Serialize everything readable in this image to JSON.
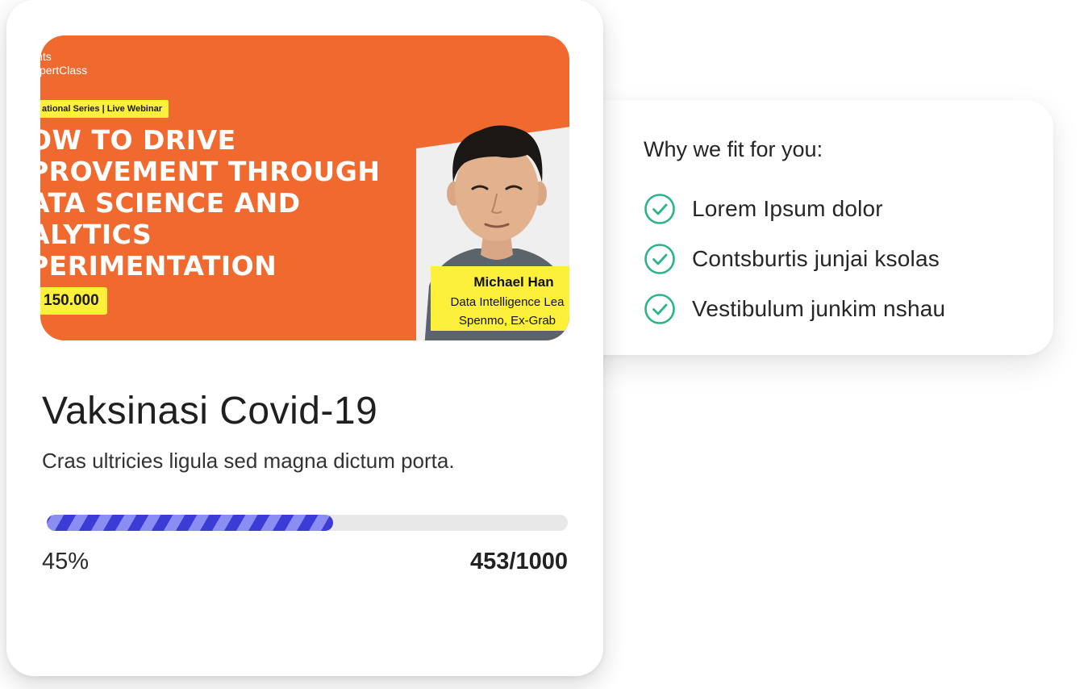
{
  "benefits": {
    "title": "Why we fit for you:",
    "items": [
      {
        "label": "Lorem Ipsum dolor",
        "icon": "check-circle-icon"
      },
      {
        "label": "Contsburtis junjai ksolas",
        "icon": "check-circle-icon"
      },
      {
        "label": "Vestibulum junkim nshau",
        "icon": "check-circle-icon"
      }
    ]
  },
  "banner": {
    "brand_line1": "ints",
    "brand_line2": "xpertClass",
    "series": "ational Series | Live Webinar",
    "headline": [
      "OW TO DRIVE",
      "PROVEMENT THROUGH",
      "ATA SCIENCE AND",
      "ALYTICS",
      "PERIMENTATION"
    ],
    "price": "150.000",
    "speaker_name": "Michael Han",
    "speaker_role_line1": "Data Intelligence Lea",
    "speaker_role_line2": "Spenmo, Ex-Grab"
  },
  "card": {
    "title": "Vaksinasi Covid-19",
    "description": "Cras ultricies ligula sed magna dictum porta.",
    "progress_fraction": 0.55,
    "progress_percent_label": "45%",
    "progress_count_label": "453/1000"
  },
  "colors": {
    "accent": "#3b3bd6",
    "accent_light": "#8b8df2",
    "check": "#2ab38c",
    "banner_orange": "#f06a2f",
    "banner_yellow": "#fdf03a"
  }
}
